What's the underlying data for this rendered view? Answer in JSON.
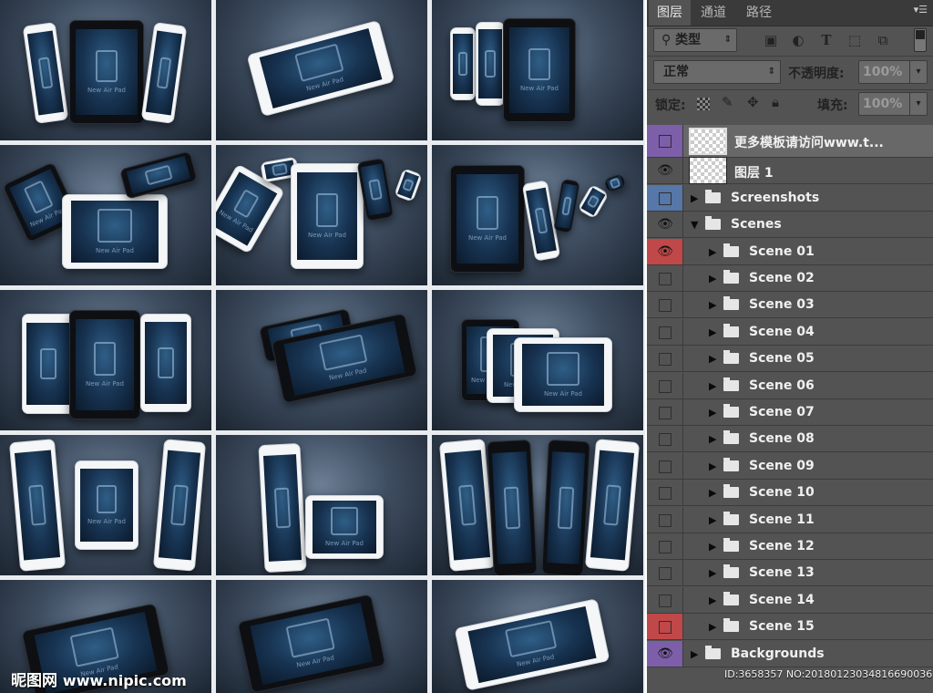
{
  "mockup": {
    "screen_caption": "New Air Pad",
    "colors": {
      "background": "#2f3b4b",
      "screen": "#173250",
      "white_device": "#f4f6f8",
      "black_device": "#0d0f13"
    }
  },
  "watermark": {
    "logo_text": "昵图网",
    "site_url": "www.nipic.com",
    "image_id": "ID:3658357 NO:20180123034816690036"
  },
  "layers_panel": {
    "tabs": [
      {
        "label": "图层",
        "active": true
      },
      {
        "label": "通道",
        "active": false
      },
      {
        "label": "路径",
        "active": false
      }
    ],
    "menu_icon": "panel-menu-icon",
    "filter": {
      "label": "⚲ 类型",
      "icons": [
        "image-filter-icon",
        "adjustment-filter-icon",
        "type-filter-icon",
        "shape-filter-icon",
        "smart-object-filter-icon"
      ]
    },
    "blend_mode": "正常",
    "opacity_label": "不透明度:",
    "opacity_value": "100%",
    "lock_label": "锁定:",
    "fill_label": "填充:",
    "fill_value": "100%",
    "layers": [
      {
        "name": "更多模板请访问www.t...",
        "kind": "layer",
        "visible": false,
        "color": "#7c5fa8",
        "selected": true,
        "indent": 0
      },
      {
        "name": "图层 1",
        "kind": "layer",
        "visible": true,
        "color": "",
        "selected": false,
        "indent": 0
      },
      {
        "name": "Screenshots",
        "kind": "group",
        "expanded": false,
        "visible": false,
        "color": "#5677a7",
        "indent": 0
      },
      {
        "name": "Scenes",
        "kind": "group",
        "expanded": true,
        "visible": true,
        "color": "",
        "indent": 0
      },
      {
        "name": "Scene 01",
        "kind": "group",
        "expanded": false,
        "visible": true,
        "color": "#c04848",
        "indent": 1
      },
      {
        "name": "Scene 02",
        "kind": "group",
        "expanded": false,
        "visible": false,
        "color": "",
        "indent": 1
      },
      {
        "name": "Scene 03",
        "kind": "group",
        "expanded": false,
        "visible": false,
        "color": "",
        "indent": 1
      },
      {
        "name": "Scene 04",
        "kind": "group",
        "expanded": false,
        "visible": false,
        "color": "",
        "indent": 1
      },
      {
        "name": "Scene 05",
        "kind": "group",
        "expanded": false,
        "visible": false,
        "color": "",
        "indent": 1
      },
      {
        "name": "Scene 06",
        "kind": "group",
        "expanded": false,
        "visible": false,
        "color": "",
        "indent": 1
      },
      {
        "name": "Scene 07",
        "kind": "group",
        "expanded": false,
        "visible": false,
        "color": "",
        "indent": 1
      },
      {
        "name": "Scene 08",
        "kind": "group",
        "expanded": false,
        "visible": false,
        "color": "",
        "indent": 1
      },
      {
        "name": "Scene 09",
        "kind": "group",
        "expanded": false,
        "visible": false,
        "color": "",
        "indent": 1
      },
      {
        "name": "Scene 10",
        "kind": "group",
        "expanded": false,
        "visible": false,
        "color": "",
        "indent": 1
      },
      {
        "name": "Scene 11",
        "kind": "group",
        "expanded": false,
        "visible": false,
        "color": "",
        "indent": 1
      },
      {
        "name": "Scene 12",
        "kind": "group",
        "expanded": false,
        "visible": false,
        "color": "",
        "indent": 1
      },
      {
        "name": "Scene 13",
        "kind": "group",
        "expanded": false,
        "visible": false,
        "color": "",
        "indent": 1
      },
      {
        "name": "Scene 14",
        "kind": "group",
        "expanded": false,
        "visible": false,
        "color": "",
        "indent": 1
      },
      {
        "name": "Scene 15",
        "kind": "group",
        "expanded": false,
        "visible": false,
        "color": "#c04848",
        "indent": 1
      },
      {
        "name": "Backgrounds",
        "kind": "group",
        "expanded": false,
        "visible": true,
        "color": "#7c5fa8",
        "indent": 0
      }
    ]
  }
}
